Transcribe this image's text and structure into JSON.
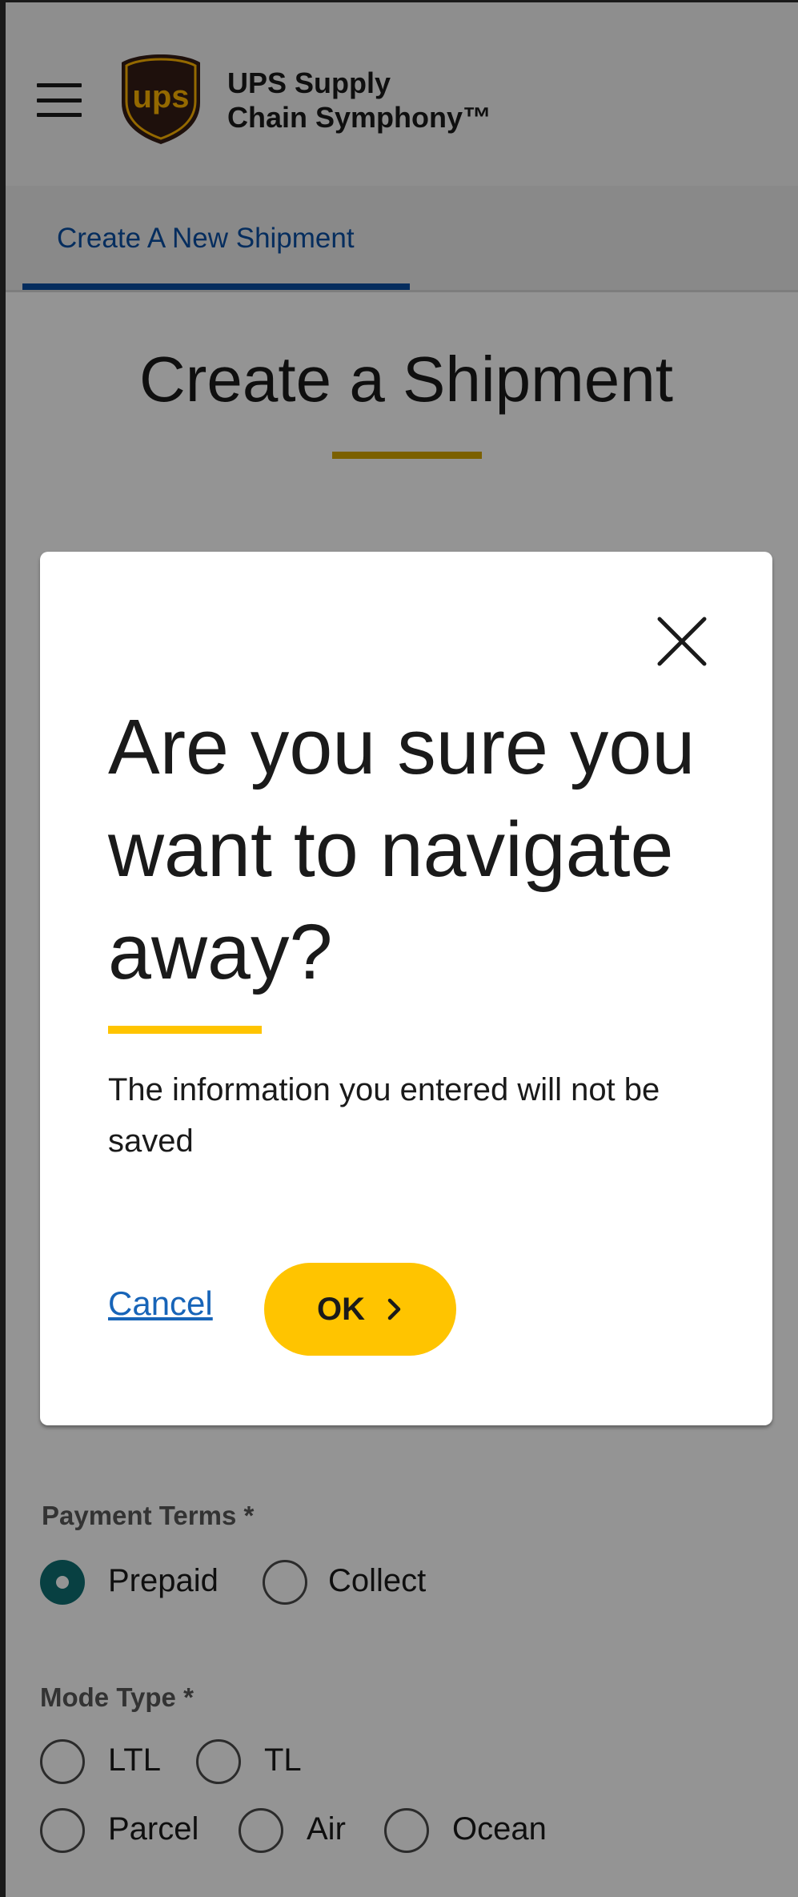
{
  "header": {
    "brand_line1": "UPS Supply",
    "brand_line2": "Chain Symphony™",
    "logo_text": "ups"
  },
  "tabs": [
    {
      "label": "Create A New Shipment",
      "active": true
    }
  ],
  "page": {
    "title": "Create a Shipment"
  },
  "form": {
    "payment_terms": {
      "label": "Payment Terms  *",
      "options": [
        {
          "label": "Prepaid",
          "checked": true
        },
        {
          "label": "Collect",
          "checked": false
        }
      ]
    },
    "mode_type": {
      "label": "Mode Type *",
      "options": [
        {
          "label": "LTL",
          "checked": false
        },
        {
          "label": "TL",
          "checked": false
        },
        {
          "label": "Parcel",
          "checked": false
        },
        {
          "label": "Air",
          "checked": false
        },
        {
          "label": "Ocean",
          "checked": false
        }
      ]
    }
  },
  "modal": {
    "title": "Are you sure you want to navigate away?",
    "message": "The information you entered will not be saved",
    "cancel_label": "Cancel",
    "ok_label": "OK"
  },
  "colors": {
    "accent_yellow": "#ffc400",
    "title_underline": "#d4a500",
    "tab_blue": "#0a4fa3",
    "link_blue": "#1764b8",
    "radio_checked": "#0f6f73",
    "ups_brown": "#351c15"
  }
}
